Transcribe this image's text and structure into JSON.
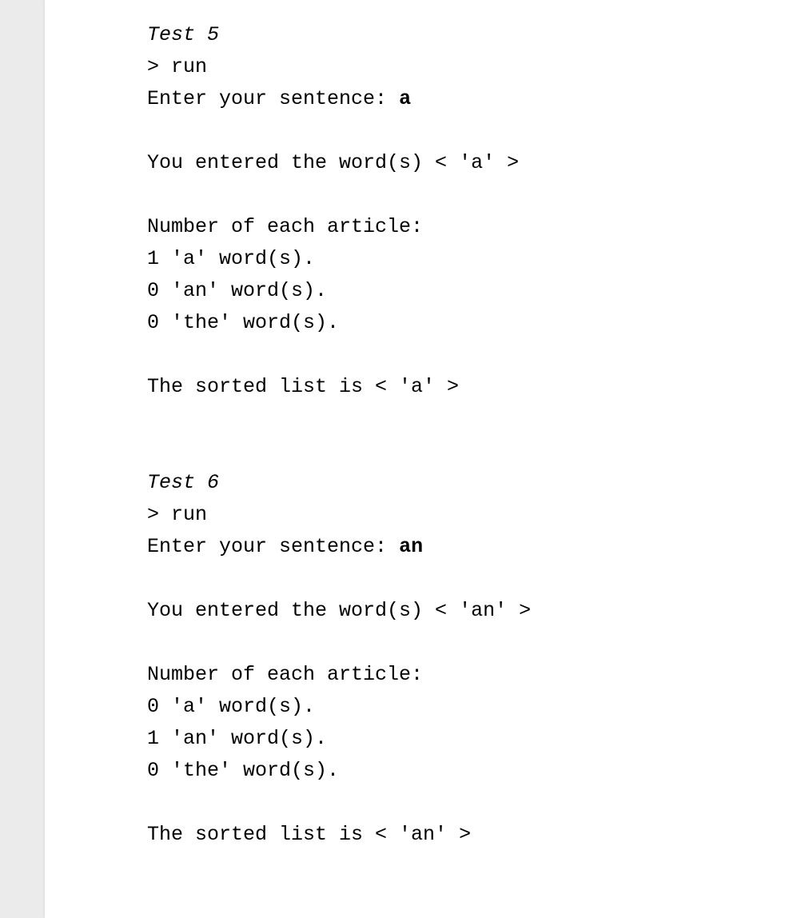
{
  "test5": {
    "header": "Test 5",
    "run": "> run",
    "prompt_prefix": "Enter your sentence: ",
    "prompt_input": "a",
    "entered": "You entered the word(s) < 'a' >",
    "articles_header": "Number of each article:",
    "count_a": "1 'a' word(s).",
    "count_an": "0 'an' word(s).",
    "count_the": "0 'the' word(s).",
    "sorted": "The sorted list is < 'a' >"
  },
  "test6": {
    "header": "Test 6",
    "run": "> run",
    "prompt_prefix": "Enter your sentence: ",
    "prompt_input": "an",
    "entered": "You entered the word(s) < 'an' >",
    "articles_header": "Number of each article:",
    "count_a": "0 'a' word(s).",
    "count_an": "1 'an' word(s).",
    "count_the": "0 'the' word(s).",
    "sorted": "The sorted list is < 'an' >"
  }
}
